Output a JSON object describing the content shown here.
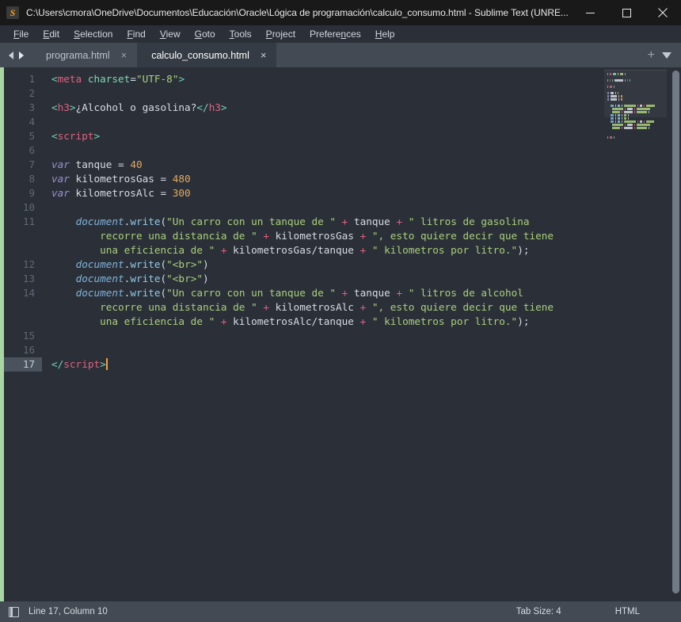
{
  "window": {
    "title": "C:\\Users\\cmora\\OneDrive\\Documentos\\Educación\\Oracle\\Lógica de programación\\calculo_consumo.html - Sublime Text (UNRE...",
    "logo_glyph": "S",
    "controls": {
      "minimize": "minimize-icon",
      "maximize": "maximize-icon",
      "close": "close-icon"
    }
  },
  "menubar": {
    "items": [
      {
        "pre": "",
        "key": "F",
        "post": "ile"
      },
      {
        "pre": "",
        "key": "E",
        "post": "dit"
      },
      {
        "pre": "",
        "key": "S",
        "post": "election"
      },
      {
        "pre": "",
        "key": "F",
        "post": "ind"
      },
      {
        "pre": "",
        "key": "V",
        "post": "iew"
      },
      {
        "pre": "",
        "key": "G",
        "post": "oto"
      },
      {
        "pre": "",
        "key": "T",
        "post": "ools"
      },
      {
        "pre": "",
        "key": "P",
        "post": "roject"
      },
      {
        "pre": "Prefere",
        "key": "n",
        "post": "ces"
      },
      {
        "pre": "",
        "key": "H",
        "post": "elp"
      }
    ]
  },
  "tabbar": {
    "nav_prev": "prev-tab-arrow",
    "nav_next": "next-tab-arrow",
    "tabs": [
      {
        "label": "programa.html",
        "active": false,
        "close": "×"
      },
      {
        "label": "calculo_consumo.html",
        "active": true,
        "close": "×"
      }
    ],
    "add_label": "+",
    "menu_label": "tab-list-dropdown"
  },
  "editor": {
    "line_count": 17,
    "active_line": 17,
    "lines": [
      {
        "n": 1,
        "tokens": [
          {
            "t": "<",
            "c": "t-punct"
          },
          {
            "t": "meta",
            "c": "t-tag"
          },
          {
            "t": " ",
            "c": "t-text"
          },
          {
            "t": "charset",
            "c": "t-attr"
          },
          {
            "t": "=",
            "c": "t-eq"
          },
          {
            "t": "\"UTF-8\"",
            "c": "t-str"
          },
          {
            "t": ">",
            "c": "t-punct"
          }
        ]
      },
      {
        "n": 2,
        "tokens": []
      },
      {
        "n": 3,
        "tokens": [
          {
            "t": "<",
            "c": "t-punct"
          },
          {
            "t": "h3",
            "c": "t-tag"
          },
          {
            "t": ">",
            "c": "t-punct"
          },
          {
            "t": "¿Alcohol o gasolina?",
            "c": "t-text"
          },
          {
            "t": "</",
            "c": "t-punct"
          },
          {
            "t": "h3",
            "c": "t-tag"
          },
          {
            "t": ">",
            "c": "t-punct"
          }
        ]
      },
      {
        "n": 4,
        "tokens": []
      },
      {
        "n": 5,
        "tokens": [
          {
            "t": "<",
            "c": "t-punct"
          },
          {
            "t": "script",
            "c": "t-tag"
          },
          {
            "t": ">",
            "c": "t-punct"
          }
        ]
      },
      {
        "n": 6,
        "tokens": []
      },
      {
        "n": 7,
        "tokens": [
          {
            "t": "var",
            "c": "t-kw"
          },
          {
            "t": " tanque ",
            "c": "t-var"
          },
          {
            "t": "=",
            "c": "t-eq"
          },
          {
            "t": " ",
            "c": "t-var"
          },
          {
            "t": "40",
            "c": "t-num"
          }
        ]
      },
      {
        "n": 8,
        "tokens": [
          {
            "t": "var",
            "c": "t-kw"
          },
          {
            "t": " kilometrosGas ",
            "c": "t-var"
          },
          {
            "t": "=",
            "c": "t-eq"
          },
          {
            "t": " ",
            "c": "t-var"
          },
          {
            "t": "480",
            "c": "t-num"
          }
        ]
      },
      {
        "n": 9,
        "tokens": [
          {
            "t": "var",
            "c": "t-kw"
          },
          {
            "t": " kilometrosAlc ",
            "c": "t-var"
          },
          {
            "t": "=",
            "c": "t-eq"
          },
          {
            "t": " ",
            "c": "t-var"
          },
          {
            "t": "300",
            "c": "t-num"
          }
        ]
      },
      {
        "n": 10,
        "tokens": []
      },
      {
        "n": 11,
        "tokens": [
          {
            "t": "    ",
            "c": "t-text"
          },
          {
            "t": "document",
            "c": "t-obj"
          },
          {
            "t": ".",
            "c": "t-text"
          },
          {
            "t": "write",
            "c": "t-fn"
          },
          {
            "t": "(",
            "c": "t-paren"
          },
          {
            "t": "\"Un carro con un tanque de \"",
            "c": "t-str"
          },
          {
            "t": " + ",
            "c": "t-op"
          },
          {
            "t": "tanque",
            "c": "t-var"
          },
          {
            "t": " + ",
            "c": "t-op"
          },
          {
            "t": "\" litros de gasolina",
            "c": "t-str"
          }
        ]
      },
      {
        "n": null,
        "tokens": [
          {
            "t": "        recorre una distancia de \"",
            "c": "t-str"
          },
          {
            "t": " + ",
            "c": "t-op"
          },
          {
            "t": "kilometrosGas",
            "c": "t-var"
          },
          {
            "t": " + ",
            "c": "t-op"
          },
          {
            "t": "\", esto quiere decir que tiene",
            "c": "t-str"
          }
        ]
      },
      {
        "n": null,
        "tokens": [
          {
            "t": "        una eficiencia de \"",
            "c": "t-str"
          },
          {
            "t": " + ",
            "c": "t-op"
          },
          {
            "t": "kilometrosGas/tanque",
            "c": "t-var"
          },
          {
            "t": " + ",
            "c": "t-op"
          },
          {
            "t": "\" kilometros por litro.\"",
            "c": "t-str"
          },
          {
            "t": ");",
            "c": "t-paren"
          }
        ]
      },
      {
        "n": 12,
        "tokens": [
          {
            "t": "    ",
            "c": "t-text"
          },
          {
            "t": "document",
            "c": "t-obj"
          },
          {
            "t": ".",
            "c": "t-text"
          },
          {
            "t": "write",
            "c": "t-fn"
          },
          {
            "t": "(",
            "c": "t-paren"
          },
          {
            "t": "\"<br>\"",
            "c": "t-str"
          },
          {
            "t": ")",
            "c": "t-paren"
          }
        ]
      },
      {
        "n": 13,
        "tokens": [
          {
            "t": "    ",
            "c": "t-text"
          },
          {
            "t": "document",
            "c": "t-obj"
          },
          {
            "t": ".",
            "c": "t-text"
          },
          {
            "t": "write",
            "c": "t-fn"
          },
          {
            "t": "(",
            "c": "t-paren"
          },
          {
            "t": "\"<br>\"",
            "c": "t-str"
          },
          {
            "t": ")",
            "c": "t-paren"
          }
        ]
      },
      {
        "n": 14,
        "tokens": [
          {
            "t": "    ",
            "c": "t-text"
          },
          {
            "t": "document",
            "c": "t-obj"
          },
          {
            "t": ".",
            "c": "t-text"
          },
          {
            "t": "write",
            "c": "t-fn"
          },
          {
            "t": "(",
            "c": "t-paren"
          },
          {
            "t": "\"Un carro con un tanque de \"",
            "c": "t-str"
          },
          {
            "t": " + ",
            "c": "t-op"
          },
          {
            "t": "tanque",
            "c": "t-var"
          },
          {
            "t": " + ",
            "c": "t-op"
          },
          {
            "t": "\" litros de alcohol",
            "c": "t-str"
          }
        ]
      },
      {
        "n": null,
        "tokens": [
          {
            "t": "        recorre una distancia de \"",
            "c": "t-str"
          },
          {
            "t": " + ",
            "c": "t-op"
          },
          {
            "t": "kilometrosAlc",
            "c": "t-var"
          },
          {
            "t": " + ",
            "c": "t-op"
          },
          {
            "t": "\", esto quiere decir que tiene",
            "c": "t-str"
          }
        ]
      },
      {
        "n": null,
        "tokens": [
          {
            "t": "        una eficiencia de \"",
            "c": "t-str"
          },
          {
            "t": " + ",
            "c": "t-op"
          },
          {
            "t": "kilometrosAlc/tanque",
            "c": "t-var"
          },
          {
            "t": " + ",
            "c": "t-op"
          },
          {
            "t": "\" kilometros por litro.\"",
            "c": "t-str"
          },
          {
            "t": ");",
            "c": "t-paren"
          }
        ]
      },
      {
        "n": 15,
        "tokens": []
      },
      {
        "n": 16,
        "tokens": []
      },
      {
        "n": 17,
        "tokens": [
          {
            "t": "</",
            "c": "t-punct"
          },
          {
            "t": "script",
            "c": "t-tag"
          },
          {
            "t": ">",
            "c": "t-punct"
          }
        ],
        "cursor": true
      }
    ]
  },
  "statusbar": {
    "icon": "sidebar-toggle-icon",
    "position": "Line 17, Column 10",
    "tab_size": "Tab Size: 4",
    "syntax": "HTML"
  },
  "colors": {
    "titlebar_bg": "#191919",
    "chrome_bg": "#2b3038",
    "tabbar_bg": "#434a54",
    "active_tab_bg": "#353b44",
    "editor_bg": "#2b3038",
    "fold_stripe": "#a8d5a2",
    "cursor": "#f0a343",
    "accent_logo": "#f6a01a",
    "string": "#a9cf7a",
    "tag": "#e0607e",
    "number": "#e2a860",
    "keyword": "#9a8fd0"
  }
}
